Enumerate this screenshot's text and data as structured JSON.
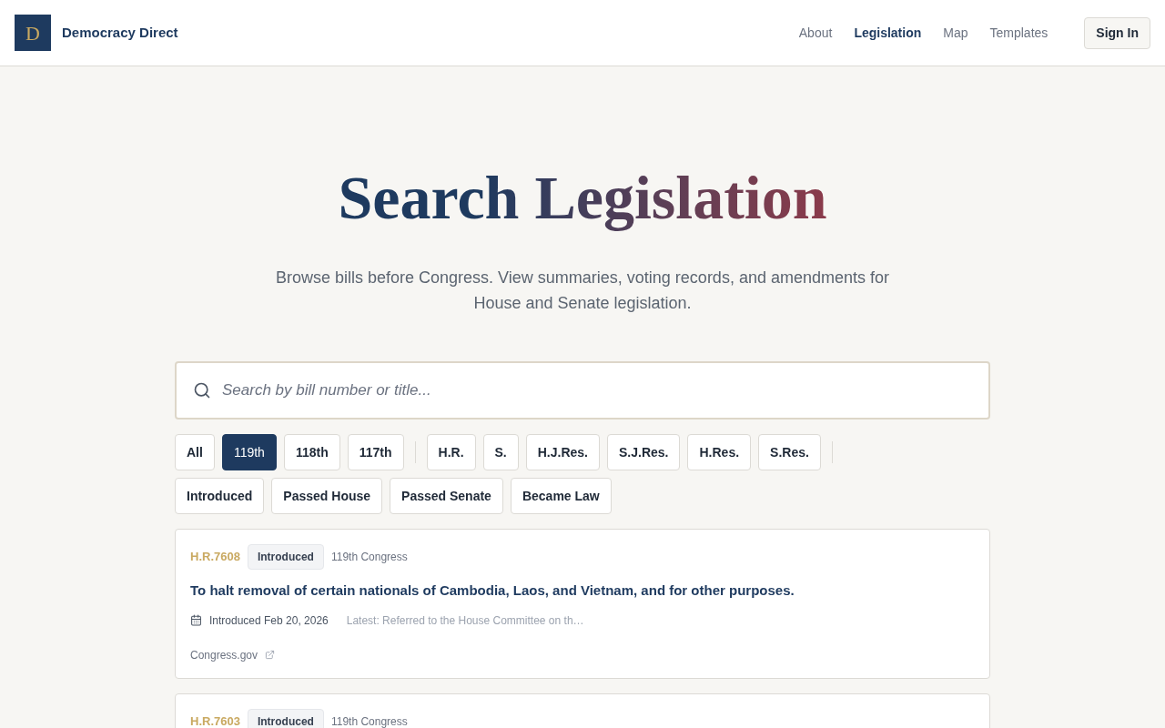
{
  "header": {
    "logo_letter": "D",
    "brand": "Democracy Direct",
    "nav": [
      {
        "label": "About",
        "selected": false
      },
      {
        "label": "Legislation",
        "selected": true
      },
      {
        "label": "Map",
        "selected": false
      },
      {
        "label": "Templates",
        "selected": false
      }
    ],
    "sign_in": "Sign In"
  },
  "hero": {
    "title": "Search Legislation",
    "subtitle": "Browse bills before Congress. View summaries, voting records, and amendments for House and Senate legislation."
  },
  "search": {
    "placeholder": "Search by bill number or title..."
  },
  "filter_rows": [
    {
      "groups": [
        [
          {
            "label": "All",
            "selected": false
          },
          {
            "label": "119th",
            "selected": true
          },
          {
            "label": "118th",
            "selected": false
          },
          {
            "label": "117th",
            "selected": false
          }
        ],
        [
          {
            "label": "H.R.",
            "selected": false
          },
          {
            "label": "S.",
            "selected": false
          },
          {
            "label": "H.J.Res.",
            "selected": false
          },
          {
            "label": "S.J.Res.",
            "selected": false
          },
          {
            "label": "H.Res.",
            "selected": false
          },
          {
            "label": "S.Res.",
            "selected": false
          }
        ]
      ],
      "trailing_divider": true
    },
    {
      "groups": [
        [
          {
            "label": "Introduced",
            "selected": false
          },
          {
            "label": "Passed House",
            "selected": false
          },
          {
            "label": "Passed Senate",
            "selected": false
          },
          {
            "label": "Became Law",
            "selected": false
          }
        ]
      ]
    }
  ],
  "bills": [
    {
      "number": "H.R.7608",
      "status": "Introduced",
      "congress": "119th Congress",
      "title": "To halt removal of certain nationals of Cambodia, Laos, and Vietnam, and for other purposes.",
      "introduced": "Introduced Feb 20, 2026",
      "latest": "Latest: Referred to the House Committee on th…",
      "link": "Congress.gov"
    },
    {
      "number": "H.R.7603",
      "status": "Introduced",
      "congress": "119th Congress"
    }
  ]
}
